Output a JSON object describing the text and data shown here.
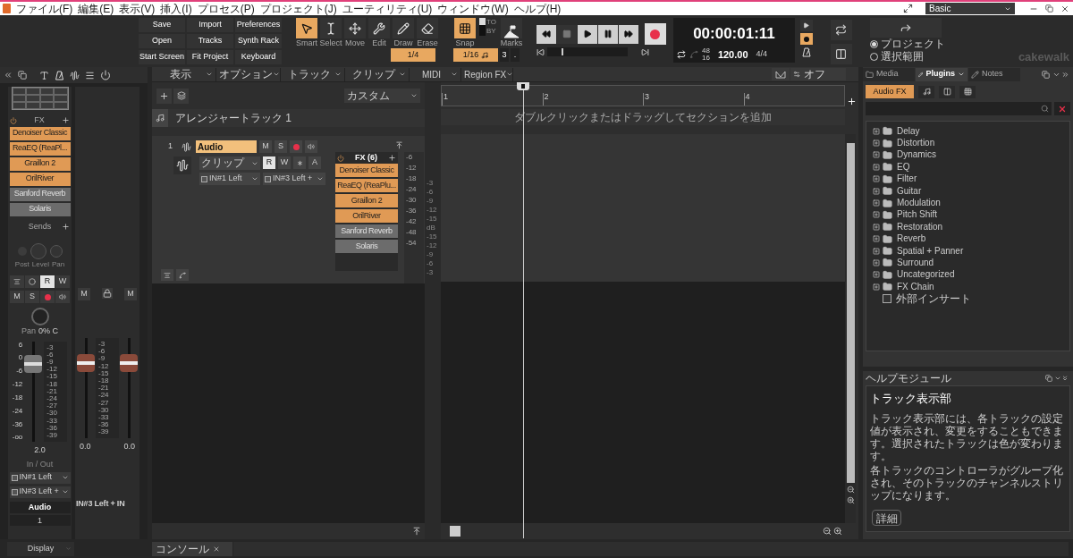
{
  "menu": [
    "ファイル(F)",
    "編集(E)",
    "表示(V)",
    "挿入(I)",
    "プロセス(P)",
    "プロジェクト(J)",
    "ユーティリティ(U)",
    "ウィンドウ(W)",
    "ヘルプ(H)"
  ],
  "workspace": "Basic",
  "file_buttons": [
    "Save",
    "Import",
    "Preferences",
    "Open",
    "Tracks",
    "Synth Rack",
    "Start Screen",
    "Fit Project",
    "Keyboard"
  ],
  "tools": [
    {
      "label": "Smart",
      "selected": true
    },
    {
      "label": "Select",
      "selected": false
    },
    {
      "label": "Move",
      "selected": false
    },
    {
      "label": "Edit",
      "selected": false
    },
    {
      "label": "Draw",
      "selected": false
    },
    {
      "label": "Erase",
      "selected": false
    }
  ],
  "draw_resolution": "1/4",
  "snap": {
    "label": "Snap",
    "on": true,
    "to_selected": true,
    "to_label": "TO",
    "by_label": "BY",
    "value": "1/16",
    "count": "3",
    "dot": "."
  },
  "marks": "Marks",
  "transport": {
    "time": "00:00:01:11",
    "sample_rate": "48",
    "bit_depth": "16",
    "tempo": "120.00",
    "meter": "4/4",
    "record_mode_on": true
  },
  "export_options": [
    {
      "label": "プロジェクト",
      "selected": true
    },
    {
      "label": "選択範囲",
      "selected": false
    }
  ],
  "logo": "cakewalk",
  "inspector": {
    "fx_label": "FX",
    "sends_label": "Sends",
    "knob_labels": [
      "Post",
      "Level",
      "Pan"
    ],
    "automation": [
      {
        "label": "R",
        "selected": true
      },
      {
        "label": "W",
        "selected": false
      }
    ],
    "mute": "M",
    "solo": "S",
    "pan_label": "Pan",
    "pan_value": "0% C",
    "fader_scale": [
      "6",
      "0",
      "-6",
      "-12",
      "-18",
      "-24",
      "-36",
      "-oo"
    ],
    "meter_scale": [
      "-3",
      "-6",
      "-9",
      "-12",
      "-15",
      "-18",
      "-21",
      "-24",
      "-27",
      "-30",
      "-33",
      "-36",
      "-39"
    ],
    "fader": {
      "level": 0.83
    },
    "fader_value": "2.0",
    "io_label": "In / Out",
    "input": "IN#1 Left",
    "output": "IN#3 Left +",
    "track_name": "Audio",
    "track_number": "1",
    "bus": {
      "mute": "M",
      "mute2": "M",
      "fader": {
        "level": 0.8
      },
      "fader2": {
        "level": 0.8
      },
      "meter_scale": [
        "-3",
        "-6",
        "-9",
        "-12",
        "-15",
        "-18",
        "-21",
        "-24",
        "-27",
        "-30",
        "-33",
        "-36",
        "-39"
      ],
      "value": "0.0",
      "value2": "0.0",
      "name": "IN#3 Left + IN"
    },
    "display": "Display"
  },
  "fx": [
    {
      "name": "Denoiser Classic",
      "bypassed": false
    },
    {
      "name": "ReaEQ (ReaPl...",
      "bypassed": false
    },
    {
      "name": "Graillon 2",
      "bypassed": false
    },
    {
      "name": "OrilRiver",
      "bypassed": false
    },
    {
      "name": "Sanford Reverb",
      "bypassed": true
    },
    {
      "name": "Solaris",
      "bypassed": true
    }
  ],
  "track_menus": [
    "表示",
    "オプション",
    "トラック",
    "クリップ",
    "MIDI",
    "Region FX"
  ],
  "snap_off": "オフ",
  "view_preset": "カスタム",
  "arranger_track": "アレンジャートラック 1",
  "track": {
    "number": "1",
    "name": "Audio",
    "mute": "M",
    "solo": "S",
    "clip_mode": "クリップ",
    "automation": [
      {
        "label": "R",
        "selected": true
      },
      {
        "label": "W",
        "selected": false
      }
    ],
    "automation_mode": "A",
    "input": "IN#1 Left",
    "output": "IN#3 Left +",
    "fx_title": "FX (6)",
    "fx": [
      {
        "name": "Denoiser Classic",
        "bypassed": false
      },
      {
        "name": "ReaEQ (ReaPlu...",
        "bypassed": false
      },
      {
        "name": "Graillon 2",
        "bypassed": false
      },
      {
        "name": "OrilRiver",
        "bypassed": false
      },
      {
        "name": "Sanford Reverb",
        "bypassed": true
      },
      {
        "name": "Solaris",
        "bypassed": true
      }
    ],
    "meter_scale": [
      "-6",
      "-12",
      "-18",
      "-24",
      "-30",
      "-36",
      "-42",
      "-48",
      "-54"
    ]
  },
  "clip_scale": [
    "-3",
    "-6",
    "-9",
    "-12",
    "-15",
    "dB",
    "-15",
    "-12",
    "-9",
    "-6",
    "-3"
  ],
  "ruler": [
    "1",
    "2",
    "3",
    "4"
  ],
  "section_hint": "ダブルクリックまたはドラッグしてセクションを追加",
  "browser": {
    "tabs": [
      {
        "label": "Media",
        "selected": false
      },
      {
        "label": "Plugins",
        "selected": true
      },
      {
        "label": "Notes",
        "selected": false
      }
    ],
    "category": "Audio FX",
    "tree": [
      {
        "label": "Delay",
        "kind": "folder",
        "expanded": false
      },
      {
        "label": "Distortion",
        "kind": "folder",
        "expanded": false
      },
      {
        "label": "Dynamics",
        "kind": "folder",
        "expanded": false
      },
      {
        "label": "EQ",
        "kind": "folder",
        "expanded": false
      },
      {
        "label": "Filter",
        "kind": "folder",
        "expanded": false
      },
      {
        "label": "Guitar",
        "kind": "folder",
        "expanded": false
      },
      {
        "label": "Modulation",
        "kind": "folder",
        "expanded": false
      },
      {
        "label": "Pitch Shift",
        "kind": "folder",
        "expanded": false
      },
      {
        "label": "Restoration",
        "kind": "folder",
        "expanded": false
      },
      {
        "label": "Reverb",
        "kind": "folder",
        "expanded": false
      },
      {
        "label": "Spatial + Panner",
        "kind": "folder",
        "expanded": false
      },
      {
        "label": "Surround",
        "kind": "folder",
        "expanded": false
      },
      {
        "label": "Uncategorized",
        "kind": "folder",
        "expanded": false
      },
      {
        "label": "FX Chain",
        "kind": "folder",
        "expanded": false
      },
      {
        "label": "外部インサート",
        "kind": "insert"
      }
    ]
  },
  "help": {
    "title": "ヘルプモジュール",
    "heading": "トラック表示部",
    "paragraphs": [
      "トラック表示部には、各トラックの設定値が表示され、変更をすることもできます。選択されたトラックは色が変わります。",
      "各トラックのコントローラがグループ化され、そのトラックのチャンネルストリップになります。"
    ],
    "button": "詳細"
  },
  "console_tab": "コンソール"
}
